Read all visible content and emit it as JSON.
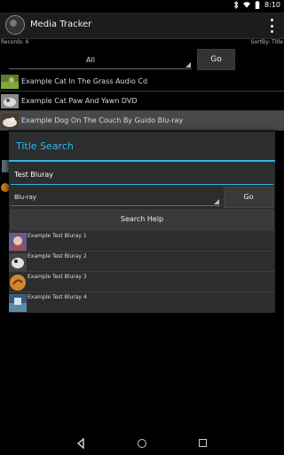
{
  "status_bar": {
    "time": "8:10",
    "icons": [
      "bluetooth-icon",
      "wifi-icon",
      "battery-icon"
    ]
  },
  "action_bar": {
    "title": "Media Tracker",
    "overflow_icon": "overflow-menu-icon"
  },
  "info": {
    "records": "Records: 6",
    "sort_by": "SortBy: Title"
  },
  "filter": {
    "selected": "All",
    "go_label": "Go"
  },
  "list": {
    "items": [
      {
        "label": "Example Cat In The Grass Audio Cd"
      },
      {
        "label": "Example Cat Paw And Yawn DVD"
      },
      {
        "label": "Example Dog On The Couch By Guido Blu-ray"
      }
    ]
  },
  "dialog": {
    "title": "Title Search",
    "search_value": "Test Bluray",
    "type_selected": "Blu-ray",
    "go_label": "Go",
    "help_label": "Search Help",
    "results": [
      {
        "label": "Example Test Bluray 1"
      },
      {
        "label": "Example Test Bluray 2"
      },
      {
        "label": "Example Test Bluray 3"
      },
      {
        "label": "Example Test Bluray 4"
      }
    ]
  },
  "colors": {
    "accent": "#33b5e5",
    "dialog_bg": "#2c2d2f",
    "selected_row": "#47484a"
  }
}
